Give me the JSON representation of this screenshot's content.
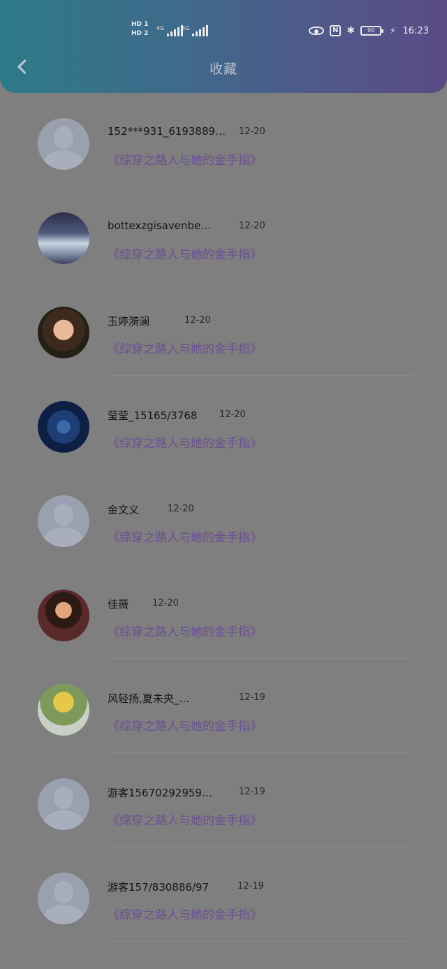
{
  "status": {
    "hd1": "HD 1",
    "hd2": "HD 2",
    "net1": "4G",
    "net2": "5G",
    "battery": "90",
    "time": "16:23"
  },
  "header": {
    "title": "收藏"
  },
  "favorites": [
    {
      "nickname": "152***931_6193889…",
      "date": "12-20",
      "book": "《综穿之路人与她的金手指》",
      "avatar": "default-avatar"
    },
    {
      "nickname": "bottexzgisavenbe…",
      "date": "12-20",
      "book": "《综穿之路人与她的金手指》",
      "avatar": "waterfall-photo"
    },
    {
      "nickname": "玉婷漪澜",
      "date": "12-20",
      "book": "《综穿之路人与她的金手指》",
      "avatar": "woman-portrait"
    },
    {
      "nickname": "莹莹_15165/3768",
      "date": "12-20",
      "book": "《综穿之路人与她的金手指》",
      "avatar": "blue-rose"
    },
    {
      "nickname": "金文义",
      "date": "12-20",
      "book": "《综穿之路人与她的金手指》",
      "avatar": "default-avatar"
    },
    {
      "nickname": "佳薇",
      "date": "12-20",
      "book": "《综穿之路人与她的金手指》",
      "avatar": "woman-selfie"
    },
    {
      "nickname": "风轻扬,夏未央_…",
      "date": "12-19",
      "book": "《综穿之路人与她的金手指》",
      "avatar": "yellow-flowers"
    },
    {
      "nickname": "游客15670292959…",
      "date": "12-19",
      "book": "《综穿之路人与她的金手指》",
      "avatar": "default-avatar"
    },
    {
      "nickname": "游客157/830886/97",
      "date": "12-19",
      "book": "《综穿之路人与她的金手指》",
      "avatar": "default-avatar"
    }
  ]
}
